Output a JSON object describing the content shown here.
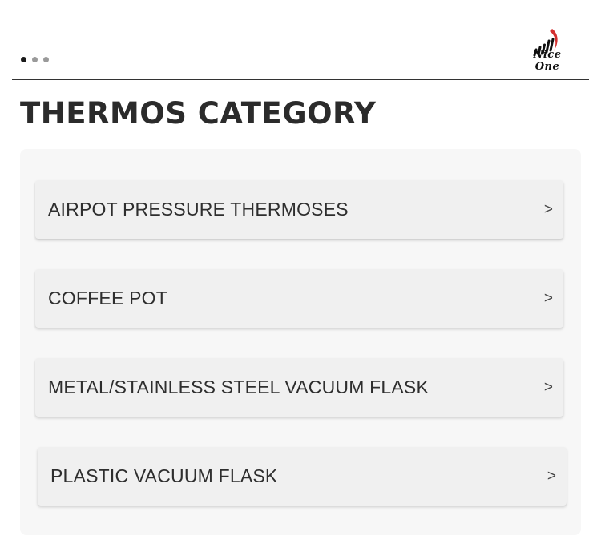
{
  "header": {
    "carousel_dots": [
      {
        "active": true
      },
      {
        "active": false
      },
      {
        "active": false
      }
    ],
    "logo_text": "Nice One",
    "logo_accent_color": "#d32f2f"
  },
  "page": {
    "title": "THERMOS CATEGORY"
  },
  "categories": [
    {
      "label": "AIRPOT PRESSURE THERMOSES",
      "arrow": ">"
    },
    {
      "label": "COFFEE POT",
      "arrow": ">"
    },
    {
      "label": "METAL/STAINLESS STEEL VACUUM FLASK",
      "arrow": ">"
    },
    {
      "label": "PLASTIC VACUUM FLASK",
      "arrow": ">"
    }
  ]
}
